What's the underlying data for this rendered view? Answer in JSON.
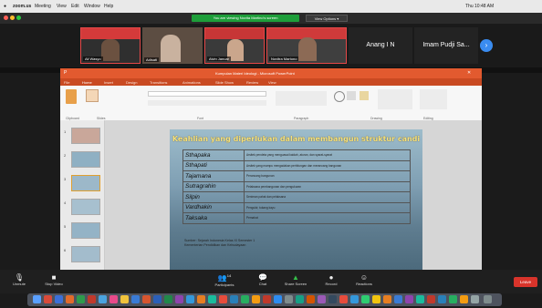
{
  "menubar": {
    "app": "zoom.us",
    "items": [
      "Meeting",
      "View",
      "Edit",
      "Window",
      "Help"
    ],
    "clock": "Thu 10:48 AM"
  },
  "zoom": {
    "banner": "You are viewing Novita Martino's screen",
    "view_options": "View Options ▾",
    "participants": [
      {
        "name": "Ali Wasyo"
      },
      {
        "name": "Adisati"
      },
      {
        "name": "Alvin Januar"
      },
      {
        "name": "Novitra Martono"
      }
    ],
    "name_tiles": [
      "Anang I N",
      "Imam Pudji Sa..."
    ],
    "next_icon": "chevron-right-icon"
  },
  "ppt": {
    "title": "Kumpulan Materi Ideologi - Microsoft PowerPoint",
    "tabs": [
      "File",
      "Home",
      "Insert",
      "Design",
      "Transitions",
      "Animations",
      "Slide Show",
      "Review",
      "View"
    ],
    "groups": [
      "Clipboard",
      "Slides",
      "Font",
      "Paragraph",
      "Drawing",
      "Editing"
    ],
    "slide_numbers": [
      "1",
      "2",
      "3",
      "4",
      "5",
      "6"
    ]
  },
  "slide": {
    "title": "Keahlian yang diperlukan dalam membangun struktur candi",
    "rows": [
      {
        "term": "Sthapaka",
        "desc": "Arsitek pendeta yang menguasai kaidah, aturan, dan syarat-syarat"
      },
      {
        "term": "Sthapati",
        "desc": "Arsitek yang mampu mengadakan perhitungan dan merancang bangunan"
      },
      {
        "term": "Tajamana",
        "desc": "Perancang bangunan"
      },
      {
        "term": "Sutragrahin",
        "desc": "Pelaksana pembangunan dan pengukuran"
      },
      {
        "term": "Silpin",
        "desc": "Seniman pahat dan pelaksana"
      },
      {
        "term": "Vardhakin",
        "desc": "Pengukir, tukang kayu"
      },
      {
        "term": "Taksaka",
        "desc": "Pemahat"
      }
    ],
    "footnote_1": "Sumber: Sejarah Indonesia Kelas XI Semester 1",
    "footnote_2": "Kementerian Pendidikan dan Kebudayaan"
  },
  "controls": {
    "mute": "Unmute",
    "video": "Stop Video",
    "participants": "Participants",
    "participant_count": "14",
    "chat": "Chat",
    "share": "Share Screen",
    "record": "Record",
    "reactions": "Reactions",
    "leave": "Leave"
  }
}
